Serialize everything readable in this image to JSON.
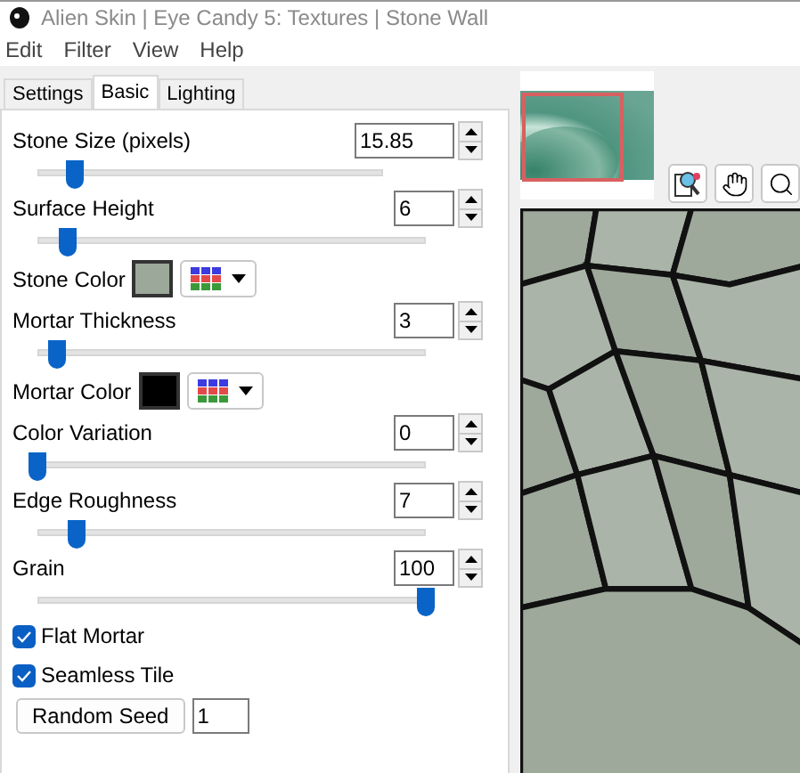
{
  "window": {
    "title": "Alien Skin | Eye Candy 5: Textures | Stone Wall"
  },
  "menu": [
    "Edit",
    "Filter",
    "View",
    "Help"
  ],
  "tabs": [
    {
      "label": "Settings",
      "selected": false
    },
    {
      "label": "Basic",
      "selected": true
    },
    {
      "label": "Lighting",
      "selected": false
    }
  ],
  "controls": [
    {
      "kind": "slider",
      "label": "Stone Size (pixels)",
      "value": "15.85",
      "level": 0.11
    },
    {
      "kind": "slider",
      "label": "Surface Height",
      "value": "6",
      "level": 0.08
    },
    {
      "kind": "color",
      "label": "Stone Color",
      "color": "#9ca89a"
    },
    {
      "kind": "slider",
      "label": "Mortar Thickness",
      "value": "3",
      "level": 0.05
    },
    {
      "kind": "color",
      "label": "Mortar Color",
      "color": "#000000"
    },
    {
      "kind": "slider",
      "label": "Color Variation",
      "value": "0",
      "level": 0
    },
    {
      "kind": "slider",
      "label": "Edge Roughness",
      "value": "7",
      "level": 0.1
    },
    {
      "kind": "slider",
      "label": "Grain",
      "value": "100",
      "level": 1
    },
    {
      "kind": "checkbox",
      "label": "Flat Mortar",
      "checked": true
    },
    {
      "kind": "checkbox",
      "label": "Seamless Tile",
      "checked": true
    },
    {
      "kind": "seed",
      "label": "Random Seed",
      "value": "1"
    }
  ]
}
